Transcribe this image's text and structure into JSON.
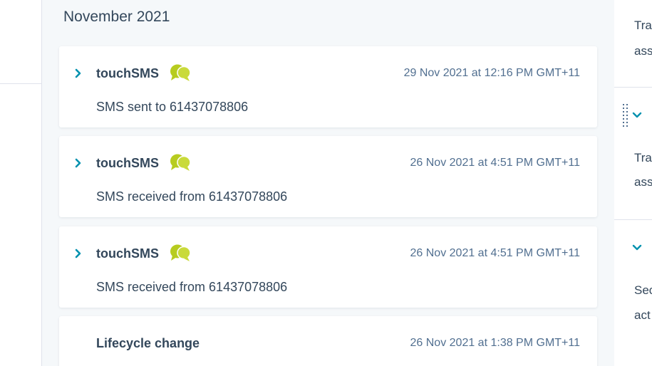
{
  "timeline": {
    "month": "November 2021",
    "cards": [
      {
        "app": "touchSMS",
        "icon": "sms-chat-bubbles-icon",
        "timestamp": "29 Nov 2021 at 12:16 PM GMT+11",
        "body": "SMS sent to 61437078806"
      },
      {
        "app": "touchSMS",
        "icon": "sms-chat-bubbles-icon",
        "timestamp": "26 Nov 2021 at 4:51 PM GMT+11",
        "body": "SMS received from 61437078806"
      },
      {
        "app": "touchSMS",
        "icon": "sms-chat-bubbles-icon",
        "timestamp": "26 Nov 2021 at 4:51 PM GMT+11",
        "body": "SMS received from 61437078806"
      },
      {
        "app": "Lifecycle change",
        "timestamp": "26 Nov 2021 at 1:38 PM GMT+11"
      }
    ]
  },
  "right_panel": {
    "section1": {
      "line1": "Tra",
      "line2": "ass"
    },
    "section2": {
      "line1": "Tra",
      "line2": "ass"
    },
    "section3": {
      "line1": "Sec",
      "line2": "act"
    }
  },
  "colors": {
    "accent_teal": "#0091ae",
    "sms_green": "#b7cc1f",
    "text_dark": "#33475b",
    "text_muted": "#516f90",
    "timeline_bg": "#f5f8fa"
  }
}
